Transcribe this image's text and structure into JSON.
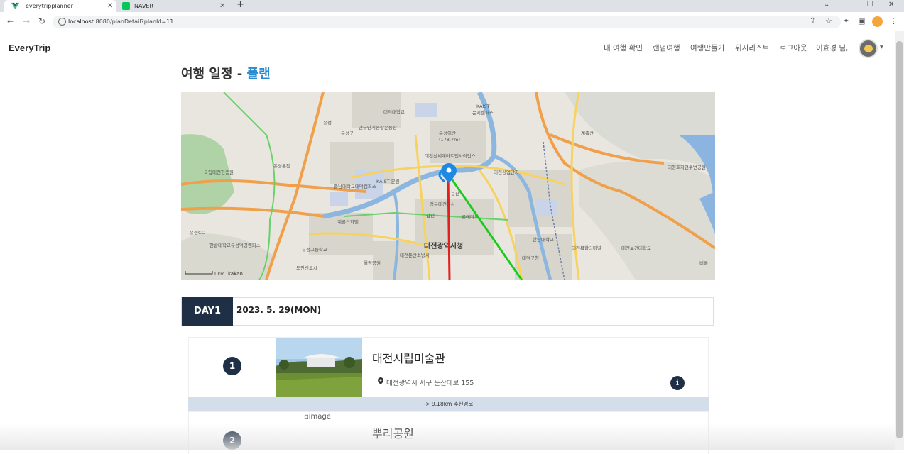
{
  "browser": {
    "tabs": [
      {
        "title": "everytripplanner",
        "active": true
      },
      {
        "title": "NAVER",
        "active": false
      }
    ],
    "url_host": "localhost",
    "url_rest": ":8080/planDetail?planId=11",
    "window_controls": {
      "minimize": "─",
      "restore": "❐",
      "close": "✕"
    }
  },
  "navbar": {
    "brand": "EveryTrip",
    "links": [
      "내 여행 확인",
      "랜덤여행",
      "여행만들기",
      "위시리스트",
      "로그아웃"
    ],
    "greeting": "이효경 님,"
  },
  "page": {
    "title_prefix": "여행 일정 - ",
    "title_plan": "플랜"
  },
  "map": {
    "scale": "1 km",
    "provider": "kakao",
    "labels": [
      "대덕대학교",
      "KAIST",
      "문지캠퍼스",
      "연구단지종합운동장",
      "유성구",
      "유성",
      "우성이산",
      "(178.7m)",
      "대전신세계아트앤사이언스",
      "계족산",
      "대청호자연수변공원",
      "국립대전현충원",
      "유성온천",
      "대전상업단지",
      "충남대학교대덕캠퍼스",
      "KAIST 본원",
      "갑천",
      "둔산",
      "정부대전청사",
      "유성CC",
      "한밭대학교유성덕명캠퍼스",
      "계룡스파텔",
      "롯데마트",
      "유성고등학교",
      "대전광역시청",
      "대전둔산소방서",
      "월평공원",
      "도안신도시",
      "대덕구청",
      "한남대학교",
      "대전복합터미널",
      "대전보건대학교",
      "비룡"
    ]
  },
  "itinerary": {
    "day_label": "DAY1",
    "date": "2023. 5. 29(MON)",
    "places": [
      {
        "num": "1",
        "name": "대전시립미술관",
        "address": "대전광역시 서구 둔산대로 155"
      },
      {
        "num": "2",
        "name": "뿌리공원",
        "image_alt": "image"
      }
    ],
    "route_text": "-> 9.18km 추천경로"
  },
  "colors": {
    "accent": "#2a8bd1",
    "dark_navy": "#1f2f45",
    "route_bar": "#d4ddea",
    "route_red": "#e31f1f",
    "route_green": "#1ec91e"
  }
}
